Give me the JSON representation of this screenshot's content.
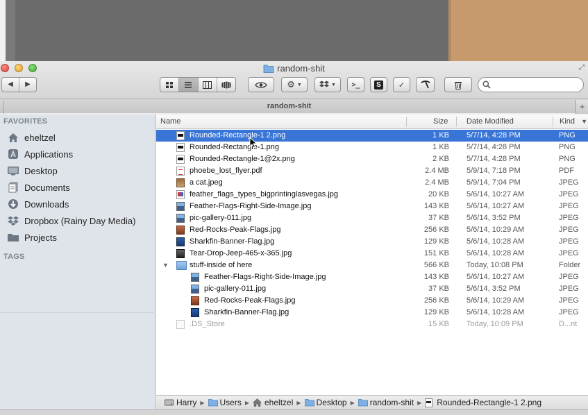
{
  "window": {
    "title": "random-shit",
    "tab_label": "random-shit",
    "new_tab": "+"
  },
  "toolbar": {
    "back": "◀",
    "forward": "▶",
    "search_placeholder": "",
    "search_value": ""
  },
  "sidebar": {
    "favorites_heading": "FAVORITES",
    "tags_heading": "TAGS",
    "items": [
      {
        "label": "eheltzel",
        "icon": "home-icon"
      },
      {
        "label": "Applications",
        "icon": "applications-icon"
      },
      {
        "label": "Desktop",
        "icon": "desktop-icon"
      },
      {
        "label": "Documents",
        "icon": "documents-icon"
      },
      {
        "label": "Downloads",
        "icon": "downloads-icon"
      },
      {
        "label": "Dropbox (Rainy Day Media)",
        "icon": "dropbox-icon"
      },
      {
        "label": "Projects",
        "icon": "folder-icon"
      }
    ]
  },
  "columns": {
    "name": "Name",
    "size": "Size",
    "date": "Date Modified",
    "kind": "Kind"
  },
  "files": [
    {
      "name": "Rounded-Rectangle-1 2.png",
      "size": "1 KB",
      "date": "5/7/14, 4:28 PM",
      "kind": "PNG",
      "icon": "png-file-icon",
      "selected": true,
      "indent": 0
    },
    {
      "name": "Rounded-Rectangle-1.png",
      "size": "1 KB",
      "date": "5/7/14, 4:28 PM",
      "kind": "PNG",
      "icon": "png-file-icon",
      "indent": 0
    },
    {
      "name": "Rounded-Rectangle-1@2x.png",
      "size": "2 KB",
      "date": "5/7/14, 4:28 PM",
      "kind": "PNG",
      "icon": "png-file-icon",
      "indent": 0
    },
    {
      "name": "phoebe_lost_flyer.pdf",
      "size": "2.4 MB",
      "date": "5/9/14, 7:18 PM",
      "kind": "PDF",
      "icon": "pdf-file-icon",
      "indent": 0
    },
    {
      "name": "a cat.jpeg",
      "size": "2.4 MB",
      "date": "5/9/14, 7:04 PM",
      "kind": "JPEG",
      "icon": "cat-image-icon",
      "indent": 0
    },
    {
      "name": "feather_flags_types_bigprintinglasvegas.jpg",
      "size": "20 KB",
      "date": "5/6/14, 10:27 AM",
      "kind": "JPEG",
      "icon": "flag-image-icon",
      "indent": 0
    },
    {
      "name": "Feather-Flags-Right-Side-Image.jpg",
      "size": "143 KB",
      "date": "5/6/14, 10:27 AM",
      "kind": "JPEG",
      "icon": "image-file-icon",
      "indent": 0
    },
    {
      "name": "pic-gallery-011.jpg",
      "size": "37 KB",
      "date": "5/6/14, 3:52 PM",
      "kind": "JPEG",
      "icon": "image-file-icon",
      "indent": 0
    },
    {
      "name": "Red-Rocks-Peak-Flags.jpg",
      "size": "256 KB",
      "date": "5/6/14, 10:29 AM",
      "kind": "JPEG",
      "icon": "rocks-image-icon",
      "indent": 0
    },
    {
      "name": "Sharkfin-Banner-Flag.jpg",
      "size": "129 KB",
      "date": "5/6/14, 10:28 AM",
      "kind": "JPEG",
      "icon": "shark-image-icon",
      "indent": 0
    },
    {
      "name": "Tear-Drop-Jeep-465-x-365.jpg",
      "size": "151 KB",
      "date": "5/6/14, 10:28 AM",
      "kind": "JPEG",
      "icon": "jeep-image-icon",
      "indent": 0
    },
    {
      "name": "stuff-inside of here",
      "size": "566 KB",
      "date": "Today, 10:08 PM",
      "kind": "Folder",
      "icon": "folder-icon",
      "indent": 0,
      "expanded": true
    },
    {
      "name": "Feather-Flags-Right-Side-Image.jpg",
      "size": "143 KB",
      "date": "5/6/14, 10:27 AM",
      "kind": "JPEG",
      "icon": "image-file-icon",
      "indent": 1
    },
    {
      "name": "pic-gallery-011.jpg",
      "size": "37 KB",
      "date": "5/6/14, 3:52 PM",
      "kind": "JPEG",
      "icon": "image-file-icon",
      "indent": 1
    },
    {
      "name": "Red-Rocks-Peak-Flags.jpg",
      "size": "256 KB",
      "date": "5/6/14, 10:29 AM",
      "kind": "JPEG",
      "icon": "rocks-image-icon",
      "indent": 1
    },
    {
      "name": "Sharkfin-Banner-Flag.jpg",
      "size": "129 KB",
      "date": "5/6/14, 10:28 AM",
      "kind": "JPEG",
      "icon": "shark-image-icon",
      "indent": 1
    },
    {
      "name": ".DS_Store",
      "size": "15 KB",
      "date": "Today, 10:09 PM",
      "kind": "D...nt",
      "icon": "document-icon",
      "indent": 0,
      "dim": true
    }
  ],
  "pathbar": [
    {
      "label": "Harry",
      "icon": "hard-drive-icon"
    },
    {
      "label": "Users",
      "icon": "folder-icon"
    },
    {
      "label": "eheltzel",
      "icon": "home-icon"
    },
    {
      "label": "Desktop",
      "icon": "desktop-icon"
    },
    {
      "label": "random-shit",
      "icon": "folder-icon"
    },
    {
      "label": "Rounded-Rectangle-1 2.png",
      "icon": "png-file-icon"
    }
  ],
  "colors": {
    "selection": "#3875d7",
    "sidebar_bg": "#dfe4ea"
  }
}
